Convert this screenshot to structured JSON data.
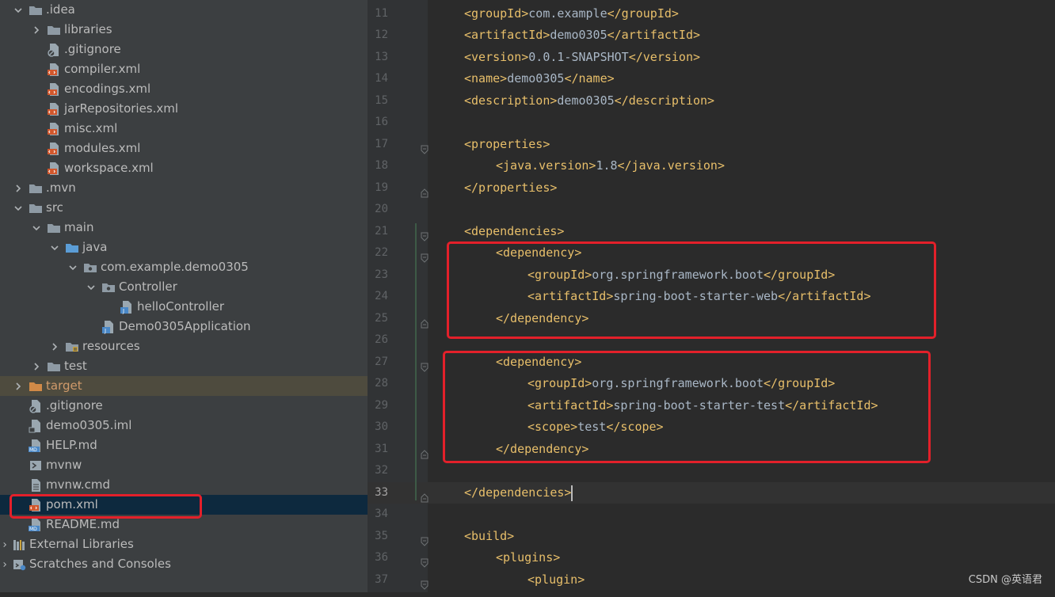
{
  "project_tree": {
    "rows": [
      {
        "label": ".idea",
        "indent": 0,
        "arrow": "down",
        "icon": "folder-icon"
      },
      {
        "label": "libraries",
        "indent": 1,
        "arrow": "right",
        "icon": "folder-icon"
      },
      {
        "label": ".gitignore",
        "indent": 1,
        "arrow": "none",
        "icon": "ignore-file-icon"
      },
      {
        "label": "compiler.xml",
        "indent": 1,
        "arrow": "none",
        "icon": "xml-file-icon"
      },
      {
        "label": "encodings.xml",
        "indent": 1,
        "arrow": "none",
        "icon": "xml-file-icon"
      },
      {
        "label": "jarRepositories.xml",
        "indent": 1,
        "arrow": "none",
        "icon": "xml-file-icon"
      },
      {
        "label": "misc.xml",
        "indent": 1,
        "arrow": "none",
        "icon": "xml-file-icon"
      },
      {
        "label": "modules.xml",
        "indent": 1,
        "arrow": "none",
        "icon": "xml-file-icon"
      },
      {
        "label": "workspace.xml",
        "indent": 1,
        "arrow": "none",
        "icon": "xml-file-icon"
      },
      {
        "label": ".mvn",
        "indent": 0,
        "arrow": "right",
        "icon": "folder-icon"
      },
      {
        "label": "src",
        "indent": 0,
        "arrow": "down",
        "icon": "folder-icon"
      },
      {
        "label": "main",
        "indent": 1,
        "arrow": "down",
        "icon": "folder-icon"
      },
      {
        "label": "java",
        "indent": 2,
        "arrow": "down",
        "icon": "source-folder-icon"
      },
      {
        "label": "com.example.demo0305",
        "indent": 3,
        "arrow": "down",
        "icon": "package-icon"
      },
      {
        "label": "Controller",
        "indent": 4,
        "arrow": "down",
        "icon": "package-icon"
      },
      {
        "label": "helloController",
        "indent": 5,
        "arrow": "none",
        "icon": "java-class-icon"
      },
      {
        "label": "Demo0305Application",
        "indent": 4,
        "arrow": "none",
        "icon": "java-class-icon"
      },
      {
        "label": "resources",
        "indent": 2,
        "arrow": "right",
        "icon": "resources-folder-icon"
      },
      {
        "label": "test",
        "indent": 1,
        "arrow": "right",
        "icon": "folder-icon"
      },
      {
        "label": "target",
        "indent": 0,
        "arrow": "right",
        "icon": "excluded-folder-icon",
        "state": "target"
      },
      {
        "label": ".gitignore",
        "indent": 0,
        "arrow": "none",
        "icon": "ignore-file-icon"
      },
      {
        "label": "demo0305.iml",
        "indent": 0,
        "arrow": "none",
        "icon": "iml-file-icon"
      },
      {
        "label": "HELP.md",
        "indent": 0,
        "arrow": "none",
        "icon": "markdown-file-icon"
      },
      {
        "label": "mvnw",
        "indent": 0,
        "arrow": "none",
        "icon": "shell-script-icon"
      },
      {
        "label": "mvnw.cmd",
        "indent": 0,
        "arrow": "none",
        "icon": "text-file-icon"
      },
      {
        "label": "pom.xml",
        "indent": 0,
        "arrow": "none",
        "icon": "maven-xml-icon",
        "state": "selected"
      },
      {
        "label": "README.md",
        "indent": 0,
        "arrow": "none",
        "icon": "markdown-file-icon"
      },
      {
        "label": "External Libraries",
        "indent": -1,
        "arrow": "right",
        "icon": "libraries-icon"
      },
      {
        "label": "Scratches and Consoles",
        "indent": -1,
        "arrow": "right",
        "icon": "scratches-icon"
      }
    ]
  },
  "editor": {
    "current_line": "33",
    "lines": [
      {
        "num": "11",
        "level": 1,
        "tokens": [
          [
            "t",
            "<groupId>"
          ],
          [
            "x",
            "com.example"
          ],
          [
            "t",
            "</groupId>"
          ]
        ]
      },
      {
        "num": "12",
        "level": 1,
        "tokens": [
          [
            "t",
            "<artifactId>"
          ],
          [
            "x",
            "demo0305"
          ],
          [
            "t",
            "</artifactId>"
          ]
        ]
      },
      {
        "num": "13",
        "level": 1,
        "tokens": [
          [
            "t",
            "<version>"
          ],
          [
            "x",
            "0.0.1-SNAPSHOT"
          ],
          [
            "t",
            "</version>"
          ]
        ]
      },
      {
        "num": "14",
        "level": 1,
        "tokens": [
          [
            "t",
            "<name>"
          ],
          [
            "x",
            "demo0305"
          ],
          [
            "t",
            "</name>"
          ]
        ]
      },
      {
        "num": "15",
        "level": 1,
        "tokens": [
          [
            "t",
            "<description>"
          ],
          [
            "x",
            "demo0305"
          ],
          [
            "t",
            "</description>"
          ]
        ]
      },
      {
        "num": "16",
        "level": 0,
        "tokens": []
      },
      {
        "num": "17",
        "level": 1,
        "fold": "open",
        "tokens": [
          [
            "t",
            "<properties>"
          ]
        ]
      },
      {
        "num": "18",
        "level": 2,
        "tokens": [
          [
            "t",
            "<java.version>"
          ],
          [
            "x",
            "1.8"
          ],
          [
            "t",
            "</java.version>"
          ]
        ]
      },
      {
        "num": "19",
        "level": 1,
        "fold": "close",
        "tokens": [
          [
            "t",
            "</properties>"
          ]
        ]
      },
      {
        "num": "20",
        "level": 0,
        "tokens": []
      },
      {
        "num": "21",
        "level": 1,
        "fold": "open",
        "tokens": [
          [
            "t",
            "<dependencies>"
          ]
        ]
      },
      {
        "num": "22",
        "level": 2,
        "fold": "open",
        "tokens": [
          [
            "t",
            "<dependency>"
          ]
        ]
      },
      {
        "num": "23",
        "level": 3,
        "tokens": [
          [
            "t",
            "<groupId>"
          ],
          [
            "x",
            "org.springframework.boot"
          ],
          [
            "t",
            "</groupId>"
          ]
        ]
      },
      {
        "num": "24",
        "level": 3,
        "tokens": [
          [
            "t",
            "<artifactId>"
          ],
          [
            "x",
            "spring-boot-starter-web"
          ],
          [
            "t",
            "</artifactId>"
          ]
        ]
      },
      {
        "num": "25",
        "level": 2,
        "fold": "close",
        "tokens": [
          [
            "t",
            "</dependency>"
          ]
        ]
      },
      {
        "num": "26",
        "level": 0,
        "tokens": []
      },
      {
        "num": "27",
        "level": 2,
        "fold": "open",
        "tokens": [
          [
            "t",
            "<dependency>"
          ]
        ]
      },
      {
        "num": "28",
        "level": 3,
        "tokens": [
          [
            "t",
            "<groupId>"
          ],
          [
            "x",
            "org.springframework.boot"
          ],
          [
            "t",
            "</groupId>"
          ]
        ]
      },
      {
        "num": "29",
        "level": 3,
        "tokens": [
          [
            "t",
            "<artifactId>"
          ],
          [
            "x",
            "spring-boot-starter-test"
          ],
          [
            "t",
            "</artifactId>"
          ]
        ]
      },
      {
        "num": "30",
        "level": 3,
        "tokens": [
          [
            "t",
            "<scope>"
          ],
          [
            "x",
            "test"
          ],
          [
            "t",
            "</scope>"
          ]
        ]
      },
      {
        "num": "31",
        "level": 2,
        "fold": "close",
        "tokens": [
          [
            "t",
            "</dependency>"
          ]
        ]
      },
      {
        "num": "32",
        "level": 0,
        "tokens": []
      },
      {
        "num": "33",
        "level": 1,
        "fold": "close",
        "tokens": [
          [
            "t",
            "</dependencies>"
          ]
        ]
      },
      {
        "num": "34",
        "level": 0,
        "tokens": []
      },
      {
        "num": "35",
        "level": 1,
        "fold": "open",
        "tokens": [
          [
            "t",
            "<build>"
          ]
        ]
      },
      {
        "num": "36",
        "level": 2,
        "fold": "open",
        "tokens": [
          [
            "t",
            "<plugins>"
          ]
        ]
      },
      {
        "num": "37",
        "level": 3,
        "fold": "open",
        "tokens": [
          [
            "t",
            "<plugin>"
          ]
        ]
      }
    ]
  },
  "annotations": {
    "highlight_color": "#e3202a"
  },
  "watermark": "CSDN @英语君",
  "colors": {
    "xml_tag": "#e8bf6a",
    "text": "#a9b7c6",
    "line_number": "#606366",
    "sidebar_bg": "#3c3f41",
    "editor_bg": "#2b2b2b",
    "selected_row": "#0d293e",
    "target_row": "#4e4b3e"
  }
}
